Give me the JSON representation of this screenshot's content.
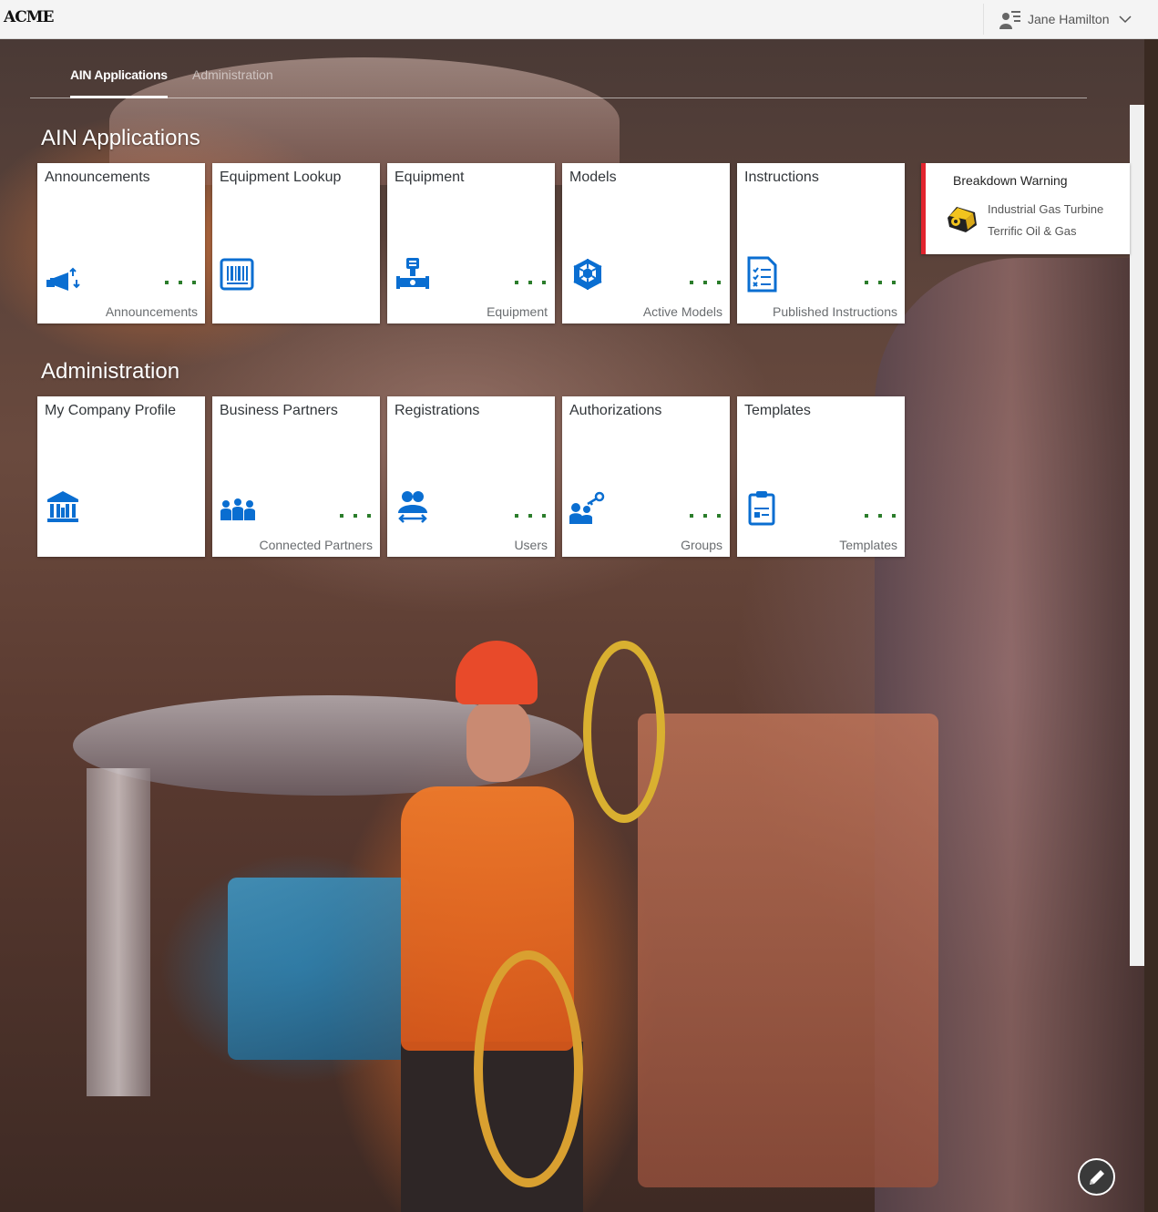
{
  "shell": {
    "logo": "ACME",
    "user_name": "Jane Hamilton",
    "user_icon": "user-list-icon",
    "menu_icon": "chevron-down-icon"
  },
  "tabs": [
    {
      "label": "AIN Applications",
      "active": true
    },
    {
      "label": "Administration",
      "active": false
    }
  ],
  "sections": {
    "ain": {
      "title": "AIN Applications",
      "tiles": [
        {
          "title": "Announcements",
          "icon": "megaphone-icon",
          "footer": "Announcements",
          "dots": true
        },
        {
          "title": "Equipment Lookup",
          "icon": "barcode-icon",
          "footer": "",
          "dots": false
        },
        {
          "title": "Equipment",
          "icon": "valve-icon",
          "footer": "Equipment",
          "dots": true
        },
        {
          "title": "Models",
          "icon": "cube-network-icon",
          "footer": "Active Models",
          "dots": true
        },
        {
          "title": "Instructions",
          "icon": "checklist-icon",
          "footer": "Published Instructions",
          "dots": true
        }
      ]
    },
    "admin": {
      "title": "Administration",
      "tiles": [
        {
          "title": "My Company Profile",
          "icon": "institution-icon",
          "footer": "",
          "dots": false
        },
        {
          "title": "Business Partners",
          "icon": "partners-icon",
          "footer": "Connected Partners",
          "dots": true
        },
        {
          "title": "Registrations",
          "icon": "user-exchange-icon",
          "footer": "Users",
          "dots": true
        },
        {
          "title": "Authorizations",
          "icon": "group-key-icon",
          "footer": "Groups",
          "dots": true
        },
        {
          "title": "Templates",
          "icon": "clipboard-icon",
          "footer": "Templates",
          "dots": true
        }
      ]
    }
  },
  "breakdown": {
    "title": "Breakdown Warning",
    "asset": "Industrial Gas Turbine",
    "company": "Terrific Oil & Gas",
    "icon": "turbine-icon",
    "accent": "#e2242e"
  },
  "colors": {
    "icon_blue": "#0a6ed1",
    "dots_green": "#2b7d2b"
  },
  "edit_button": {
    "icon": "pencil-icon"
  }
}
